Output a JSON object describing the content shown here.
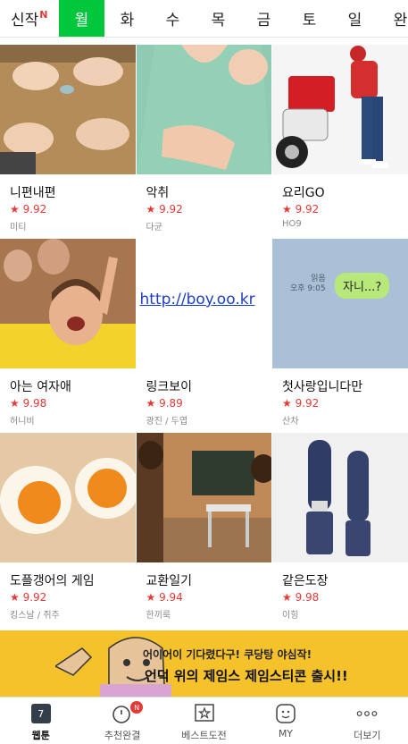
{
  "tabs": [
    {
      "label": "신작",
      "badge": "N"
    },
    {
      "label": "월"
    },
    {
      "label": "화"
    },
    {
      "label": "수"
    },
    {
      "label": "목"
    },
    {
      "label": "금"
    },
    {
      "label": "토"
    },
    {
      "label": "일"
    },
    {
      "label": "완"
    }
  ],
  "active_tab": "월",
  "comics": [
    {
      "title": "니편내편",
      "rating": "★ 9.92",
      "author": "미티"
    },
    {
      "title": "악취",
      "rating": "★ 9.92",
      "author": "다균"
    },
    {
      "title": "요리GO",
      "rating": "★ 9.92",
      "author": "HO9"
    },
    {
      "title": "아는 여자애",
      "rating": "★ 9.98",
      "author": "허니비"
    },
    {
      "title": "링크보이",
      "rating": "★ 9.89",
      "author": "광진 / 두엽",
      "thumb_text": "http://boy.oo.kr"
    },
    {
      "title": "첫사랑입니다만",
      "rating": "★ 9.92",
      "author": "산차",
      "thumb_read": "읽음",
      "thumb_time": "오후 9:05",
      "thumb_bubble": "자니...?"
    },
    {
      "title": "도플갱어의 게임",
      "rating": "★ 9.92",
      "author": "킹스날 / 쥐주"
    },
    {
      "title": "교환일기",
      "rating": "★ 9.94",
      "author": "한끼룩"
    },
    {
      "title": "같은도장",
      "rating": "★ 9.98",
      "author": "이힝"
    }
  ],
  "banner": {
    "line1": "어이어이 기다렸다구! 쿠당탕 야심작!",
    "line2": "언덕 위의 제임스 제임스티콘 출시!!"
  },
  "nav": [
    {
      "label": "웹툰",
      "icon": "calendar-icon",
      "badge": "7"
    },
    {
      "label": "추천완결",
      "icon": "timer-icon",
      "badge": "N"
    },
    {
      "label": "베스트도전",
      "icon": "star-bookmark-icon"
    },
    {
      "label": "MY",
      "icon": "smile-icon"
    },
    {
      "label": "더보기",
      "icon": "more-dots-icon"
    }
  ],
  "colors": {
    "accent": "#00c73c",
    "rating": "#e53935",
    "banner": "#f6c22b"
  }
}
